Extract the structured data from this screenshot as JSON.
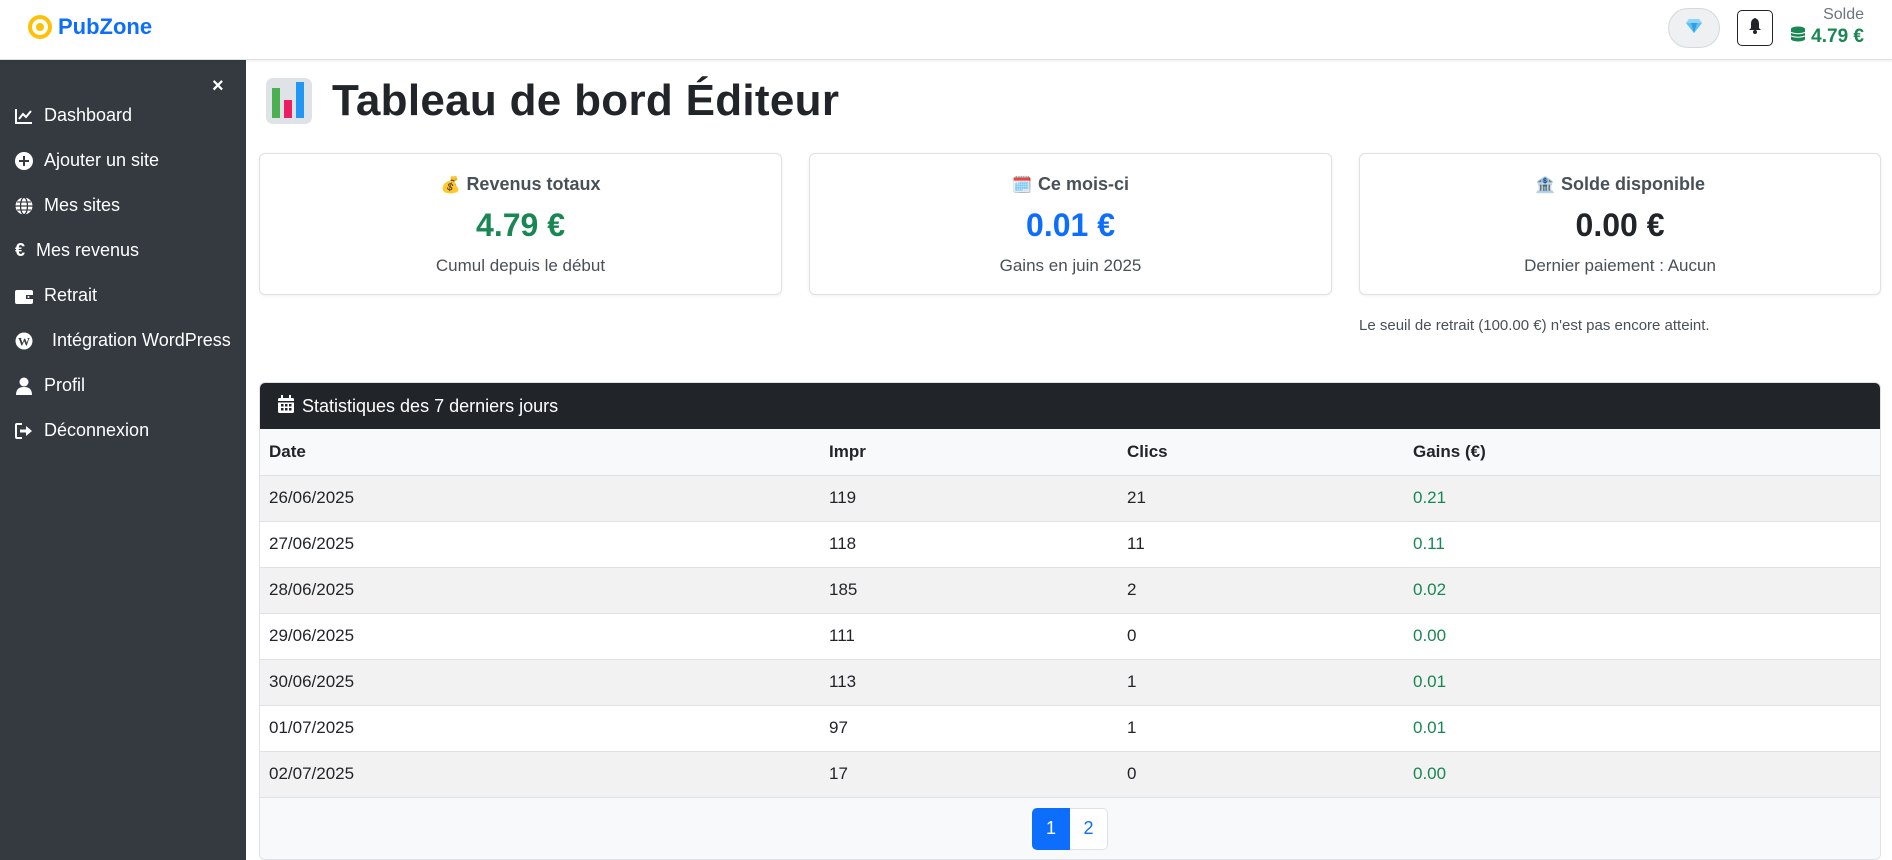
{
  "brand": {
    "name": "PubZone",
    "color": "#0d6efd",
    "icon": "target-icon"
  },
  "header": {
    "premium_icon": "diamond-icon",
    "notification_icon": "bell-icon",
    "balance_label": "Solde",
    "balance_value": "4.79 €",
    "balance_icon": "coins-icon"
  },
  "sidebar": {
    "close_label": "×",
    "items": [
      {
        "label": "Dashboard",
        "icon": "chart-line-icon"
      },
      {
        "label": "Ajouter un site",
        "icon": "plus-circle-icon"
      },
      {
        "label": "Mes sites",
        "icon": "globe-icon"
      },
      {
        "label": "Mes revenus",
        "icon": "euro-icon"
      },
      {
        "label": "Retrait",
        "icon": "wallet-icon"
      },
      {
        "label": "Intégration WordPress",
        "icon": "wordpress-icon"
      },
      {
        "label": "Profil",
        "icon": "user-icon"
      },
      {
        "label": "Déconnexion",
        "icon": "sign-out-icon"
      }
    ]
  },
  "main": {
    "title": "Tableau de bord Éditeur",
    "title_icon": "bar-chart-icon",
    "cards": [
      {
        "emoji": "💰",
        "title": "Revenus totaux",
        "value": "4.79 €",
        "subtitle": "Cumul depuis le début",
        "color": "#198754"
      },
      {
        "emoji": "🗓️",
        "title": "Ce mois-ci",
        "value": "0.01 €",
        "subtitle": "Gains en juin 2025",
        "color": "#0d6efd"
      },
      {
        "emoji": "🏦",
        "title": "Solde disponible",
        "value": "0.00 €",
        "subtitle": "Dernier paiement : Aucun",
        "color": "#212529"
      }
    ],
    "threshold_note": "Le seuil de retrait (100.00 €) n'est pas encore atteint."
  },
  "stats": {
    "header": "Statistiques des 7 derniers jours",
    "header_icon": "calendar-icon",
    "columns": [
      "Date",
      "Impr",
      "Clics",
      "Gains (€)"
    ],
    "rows": [
      [
        "26/06/2025",
        "119",
        "21",
        "0.21"
      ],
      [
        "27/06/2025",
        "118",
        "11",
        "0.11"
      ],
      [
        "28/06/2025",
        "185",
        "2",
        "0.02"
      ],
      [
        "29/06/2025",
        "111",
        "0",
        "0.00"
      ],
      [
        "30/06/2025",
        "113",
        "1",
        "0.01"
      ],
      [
        "01/07/2025",
        "97",
        "1",
        "0.01"
      ],
      [
        "02/07/2025",
        "17",
        "0",
        "0.00"
      ]
    ],
    "pagination": {
      "current": "1",
      "next": "2"
    }
  }
}
